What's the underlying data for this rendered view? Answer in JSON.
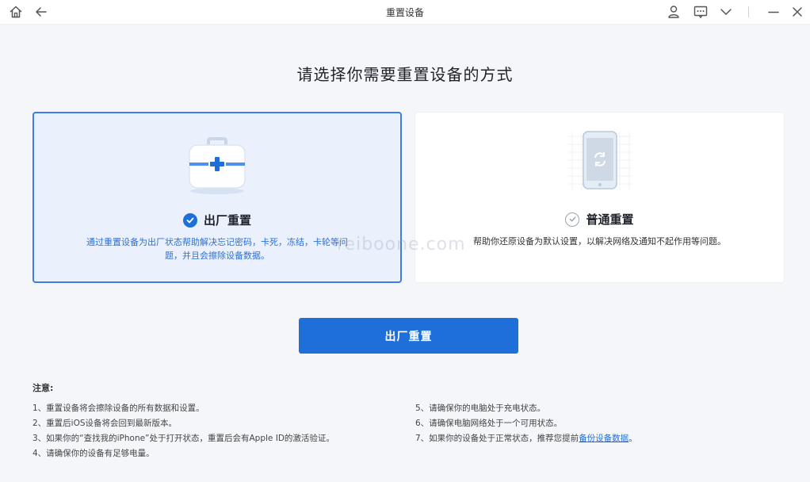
{
  "window": {
    "title": "重置设备"
  },
  "heading": "请选择你需要重置设备的方式",
  "cards": [
    {
      "title": "出厂重置",
      "selected": true,
      "icon": "toolbox-icon",
      "description_line1": "通过重置设备为出厂状态帮助解决忘记密码，卡死，冻结，卡轮等问",
      "description_line2": "题，并且会擦除设备数据。"
    },
    {
      "title": "普通重置",
      "selected": false,
      "icon": "phone-refresh-icon",
      "description_line1": "帮助你还原设备为默认设置，以解决网络及通知不起作用等问题。"
    }
  ],
  "watermark": "reiboone.com",
  "primary_button": "出厂重置",
  "notes": {
    "title": "注意:",
    "left": [
      "1、重置设备将会擦除设备的所有数据和设置。",
      "2、重置后iOS设备将会回到最新版本。",
      "3、如果你的“查找我的iPhone”处于打开状态，重置后会有Apple ID的激活验证。",
      "4、请确保你的设备有足够电量。"
    ],
    "right": [
      "5、请确保你的电脑处于充电状态。",
      "6、请确保电脑网络处于一个可用状态。"
    ],
    "right_last_prefix": "7、如果你的设备处于正常状态，推荐您提前",
    "right_last_link": "备份设备数据",
    "right_last_suffix": "。"
  },
  "colors": {
    "accent": "#1e6fd9",
    "selected_card_bg": "#eaf1fd",
    "page_bg": "#f4f6fa"
  }
}
